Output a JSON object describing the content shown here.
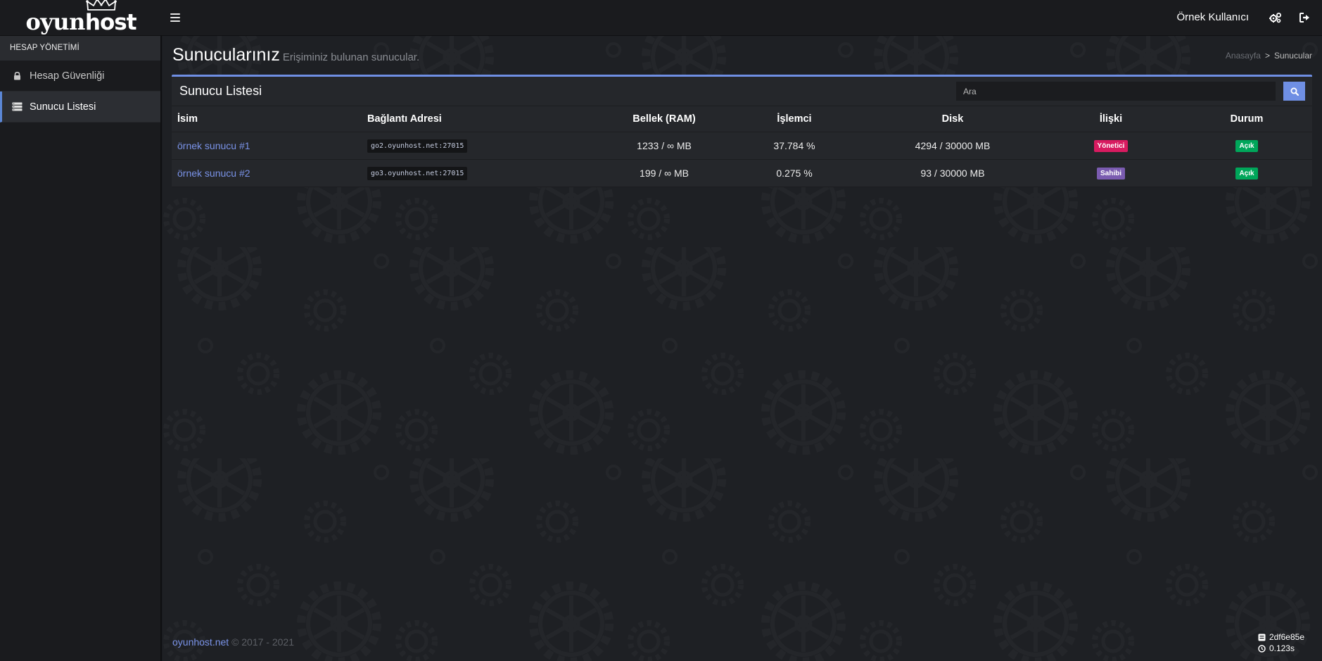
{
  "brand": {
    "logo_part1": "oyun",
    "logo_part2": "host",
    "accent": "#6f8fe4",
    "link": "#7a93e8"
  },
  "header": {
    "user_name": "Örnek Kullanıcı",
    "icons": [
      "bars-icon",
      "cogs-icon",
      "sign-out-icon"
    ]
  },
  "sidebar": {
    "section_title": "HESAP YÖNETİMİ",
    "items": [
      {
        "label": "Hesap Güvenliği",
        "icon": "lock-icon",
        "active": false
      },
      {
        "label": "Sunucu Listesi",
        "icon": "server-icon",
        "active": true
      }
    ]
  },
  "page": {
    "title": "Sunucularınız",
    "subtitle": "Erişiminiz bulunan sunucular.",
    "breadcrumb": {
      "home": "Anasayfa",
      "separator": ">",
      "current": "Sunucular"
    }
  },
  "server_list": {
    "title": "Sunucu Listesi",
    "search_placeholder": "Ara",
    "columns": [
      "İsim",
      "Bağlantı Adresi",
      "Bellek (RAM)",
      "İşlemci",
      "Disk",
      "İlişki",
      "Durum"
    ],
    "rows": [
      {
        "name": "örnek sunucu #1",
        "address": "go2.oyunhost.net:27015",
        "ram": "1233 / ∞ MB",
        "cpu": "37.784 %",
        "disk": "4294 / 30000 MB",
        "relation": "Yönetici",
        "relation_color": "#d81b60",
        "status": "Açık",
        "status_color": "#00a65a"
      },
      {
        "name": "örnek sunucu #2",
        "address": "go3.oyunhost.net:27015",
        "ram": "199 / ∞ MB",
        "cpu": "0.275 %",
        "disk": "93 / 30000 MB",
        "relation": "Sahibi",
        "relation_color": "#7a5bb0",
        "status": "Açık",
        "status_color": "#00a65a"
      }
    ]
  },
  "footer": {
    "brand_link": "oyunhost.net",
    "copyright": "© 2017 - 2021",
    "build_hash": "2df6e85e",
    "render_time": "0.123s"
  }
}
